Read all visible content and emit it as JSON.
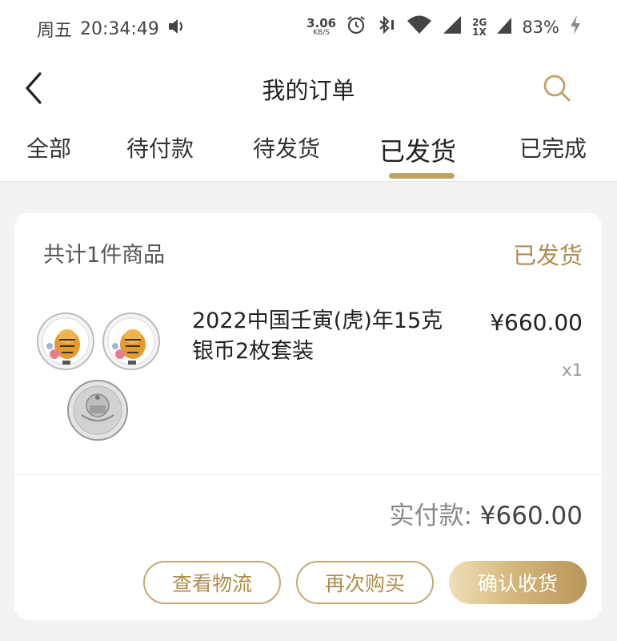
{
  "status_bar": {
    "day": "周五",
    "time": "20:34:49",
    "net_speed_value": "3.06",
    "net_speed_unit": "KB/S",
    "network_top": "2G",
    "network_bottom": "1X",
    "battery": "83%"
  },
  "navbar": {
    "title": "我的订单"
  },
  "tabs": [
    {
      "label": "全部"
    },
    {
      "label": "待付款"
    },
    {
      "label": "待发货"
    },
    {
      "label": "已发货"
    },
    {
      "label": "已完成"
    }
  ],
  "active_tab": "已发货",
  "order": {
    "count_text": "共计1件商品",
    "status": "已发货",
    "product_name": "2022中国壬寅(虎)年15克银币2枚套装",
    "price": "¥660.00",
    "quantity": "x1",
    "paid_label": "实付款:",
    "paid_amount": "¥660.00",
    "buttons": {
      "logistics": "查看物流",
      "rebuy": "再次购买",
      "confirm": "确认收货"
    }
  },
  "colors": {
    "accent": "#c1a265",
    "status_text": "#b08d4b",
    "background": "#f3f3f3"
  }
}
